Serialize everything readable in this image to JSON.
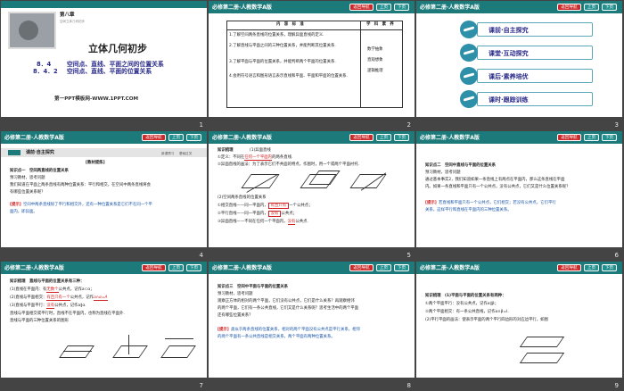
{
  "header": {
    "title": "必修第二册·人教数学A版",
    "nav_back": "返回导航",
    "nav_prev": "上页",
    "nav_next": "下页"
  },
  "slides": [
    {
      "num": "1",
      "chapter": "第八章",
      "chapter_sub": "空间立体几何初步",
      "main_title": "立体几何初步",
      "sec1_num": "8．4",
      "sec1": "空间点、直线、平面之间的位置关系",
      "sec2_num": "8．4．2",
      "sec2": "空间点、直线、平面的位置关系",
      "footer": "第一PPT模板网-WWW.1PPT.COM"
    },
    {
      "num": "2",
      "col1": "内　容　标　准",
      "col2": "学　科　素　养",
      "rows": [
        "1.了解空间两条直线的位置关系，理解异面直线的定义.",
        "2.了解直线与平面之间的三种位置关系，并能判断其位置关系.",
        "3.了解平面与平面的位置关系，并能判断两个平面的位置关系.",
        "4.会用符号语言和图形语言表示直线和平面、平面和平面的位置关系."
      ],
      "skills": [
        "数学抽象",
        "直观想象",
        "逻辑推理"
      ]
    },
    {
      "num": "3",
      "items": [
        "课前·自主探究",
        "课堂·互动探究",
        "课后·素养培优",
        "课时·跟踪训练"
      ]
    },
    {
      "num": "4",
      "section": "课前·自主探究",
      "tag1": "新课预习",
      "tag2": "基础过关",
      "lines": [
        "[教材提炼]",
        "知识点一　空间两直线的位置关系",
        "预习教材，思考问题",
        "我们知道在平面上两条直线有两种位置关系：平行和相交，在空间中两条直线将会",
        "有哪些位置关系呢？"
      ],
      "hint_label": "[提示]",
      "hint": "空间中两条直线除了平行和相交外，还有一种位置关系是它们不在同一个平",
      "hint2": "面内，即异面。"
    },
    {
      "num": "5",
      "title": "知识梳理",
      "l1": "(1)异面直线",
      "l2a": "①定义：不同在",
      "l2b": "任何一个平面内",
      "l2c": "的两条直线.",
      "l3": "②异面直线的画法：为了表示它们不共面的特点，作图时，用一个或两个平面衬托.",
      "l4": "(2)空间两条直线的位置关系",
      "r1a": "①相交直线——同一平面内，",
      "r1b": "有且只有",
      "r1c": "一个公共点；",
      "r2a": "②平行直线——同一平面内，",
      "r2b": "没有",
      "r2c": "公共点；",
      "r3a": "③异面直线——不同在任何一个平面内，",
      "r3b": "没有",
      "r3c": "公共点."
    },
    {
      "num": "6",
      "l1": "知识点二　空间中直线与平面的位置关系",
      "l2": "预习教材，思考问题",
      "l3": "通过基本事实2，我们知道如果一条直线上有两点在平面内，那么这条直线在平面",
      "l4": "内。如果一条直线和平面只有一个公共点，没有公共点，它们又是什么位置关系呢？",
      "hint_label": "[提示]",
      "hint": "若直线和平面只有一个公共点，它们相交；若没有公共点，它们平行",
      "hint2": "关系，这样平行和直线在平面内的三种位置关系。"
    },
    {
      "num": "7",
      "l1": "知识梳理　直线与平面的位置关系有三种：",
      "l2a": "(1)直线在平面内：有",
      "l2b": "无数个",
      "l2c": "公共点，记作a⊂α；",
      "l3a": "(2)直线与平面相交：",
      "l3b": "有且只有一个",
      "l3c": "公共点，记作",
      "l3d": "a∩α=A",
      "l4a": "(3)直线与平面平行：",
      "l4b": "没有",
      "l4c": "公共点，记作a∥α.",
      "l5": "直线与平面相交或平行时，直线不在平面内，也称为直线在平面外.",
      "l6": "直线与平面的三种位置关系的图形"
    },
    {
      "num": "8",
      "l1": "知识点三　空间中平面与平面的位置关系",
      "l2": "预习教材，思考问题",
      "l3": "观察正方体的相对的两个平面，它们没有公共点，它们是什么关系？再观察相邻",
      "l4": "的两个平面，它们有一条公共直线，它们又是什么关系呢？思考生活中的两个平面",
      "l5": "还有哪些位置关系？",
      "hint_label": "[提示]",
      "hint": "类似于两条直线的位置关系，相对的两个平面没有公共点是平行关系，相邻",
      "hint2": "的两个平面有一条公共直线是相交关系，两个平面有两种位置关系。"
    },
    {
      "num": "9",
      "l1": "知识梳理　(1)平面与平面的位置关系有两种：",
      "l2": "①两个平面平行：没有公共点，记作α∥β；",
      "l3": "②两个平面相交：有一条公共直线，记作α∩β=l.",
      "l4": "(2)平行平面的画法：使表示平面的两个平行四边形的对应边平行，如图"
    }
  ],
  "colors": {
    "header": "#1c7a7a",
    "accent": "#d12020",
    "background": "#444444"
  }
}
